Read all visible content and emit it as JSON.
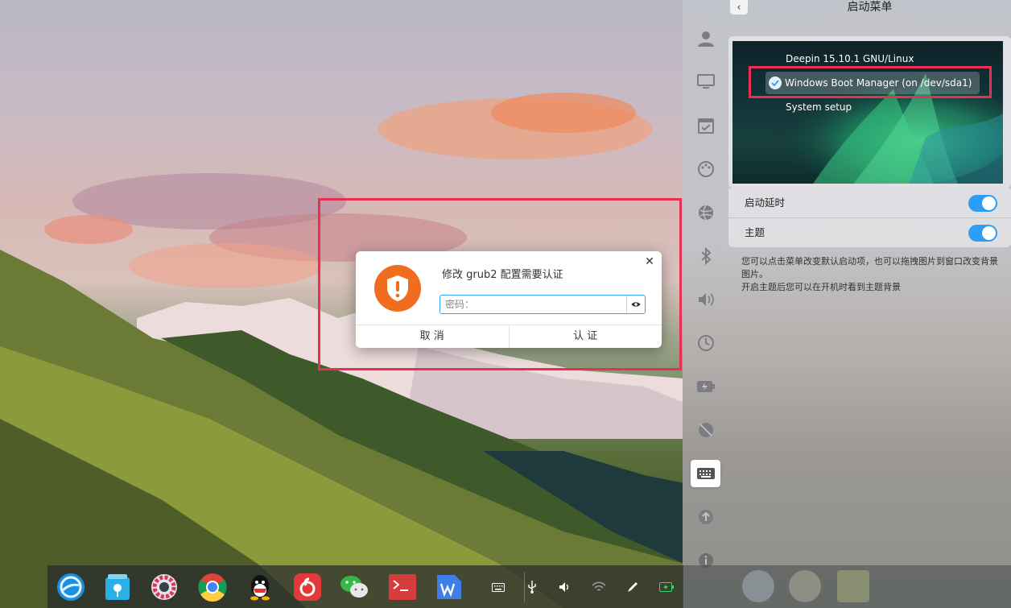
{
  "dialog": {
    "title": "修改 grub2 配置需要认证",
    "password_placeholder": "密码：",
    "cancel_label": "取 消",
    "confirm_label": "认 证",
    "close_symbol": "✕"
  },
  "control_center": {
    "back_symbol": "‹",
    "title": "启动菜单",
    "boot_entries": [
      "Deepin 15.10.1 GNU/Linux",
      "Windows Boot Manager (on /dev/sda1)",
      "System setup"
    ],
    "selected_entry": 1,
    "rows": [
      {
        "label": "启动延时",
        "on": true
      },
      {
        "label": "主题",
        "on": true
      }
    ],
    "description": [
      "您可以点击菜单改变默认启动项，也可以拖拽图片到窗口改变背景图片。",
      "开启主题后您可以在开机时看到主题背景"
    ],
    "nav_icons": [
      "account-icon",
      "display-icon",
      "default-apps-icon",
      "personalization-icon",
      "network-icon",
      "bluetooth-icon",
      "sound-icon",
      "datetime-icon",
      "power-icon",
      "mouse-icon",
      "keyboard-icon",
      "update-icon",
      "info-icon"
    ],
    "active_nav": "keyboard-icon"
  },
  "dock": {
    "apps": [
      "launcher-icon",
      "app-store-icon",
      "settings-icon",
      "chrome-icon",
      "qq-icon",
      "netease-music-icon",
      "wechat-icon",
      "terminal-icon",
      "wps-icon"
    ],
    "tray": [
      "keyboard-tray-icon",
      "usb-icon",
      "volume-icon",
      "wifi-icon",
      "pen-icon",
      "battery-icon"
    ]
  },
  "colors": {
    "highlight": "#ea2f55",
    "accent": "#2d9ef5",
    "shield": "#f06c1e"
  }
}
